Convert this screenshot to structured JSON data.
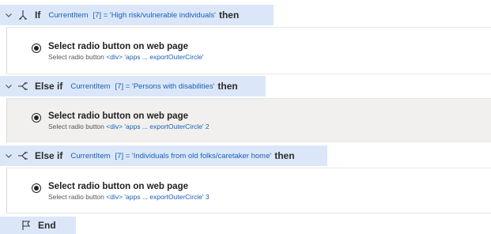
{
  "flow": {
    "if_block": {
      "keyword": "If",
      "variable": "CurrentItem",
      "expression": "[7] = 'High risk/vulnerable individuals'",
      "then": "then",
      "step": {
        "title": "Select radio button on web page",
        "sub_prefix": "Select radio button",
        "sub_link": "<div> 'apps ... exportOuterCircle'",
        "sub_suffix": ""
      }
    },
    "else_if_1": {
      "keyword": "Else if",
      "variable": "CurrentItem",
      "expression": "[7] = 'Persons with disabilities'",
      "then": "then",
      "step": {
        "title": "Select radio button on web page",
        "sub_prefix": "Select radio button",
        "sub_link": "<div> 'apps ... exportOuterCircle' 2",
        "sub_suffix": ""
      }
    },
    "else_if_2": {
      "keyword": "Else if",
      "variable": "CurrentItem",
      "expression": "[7] = 'Individuals from old folks/caretaker home'",
      "then": "then",
      "step": {
        "title": "Select radio button on web page",
        "sub_prefix": "Select radio button",
        "sub_link": "<div> 'apps ... exportOuterCircle' 3",
        "sub_suffix": ""
      }
    },
    "end": {
      "keyword": "End"
    }
  },
  "icons": {
    "chevron": "chevron-down-icon",
    "if": "if-branch-icon",
    "else_if": "else-if-branch-icon",
    "radio": "radio-button-icon",
    "end": "end-flag-icon"
  },
  "colors": {
    "header_bg": "#dbe7f9",
    "selected_bg": "#f1f0ee",
    "link": "#1a5fb4",
    "text": "#2b2b2b"
  }
}
